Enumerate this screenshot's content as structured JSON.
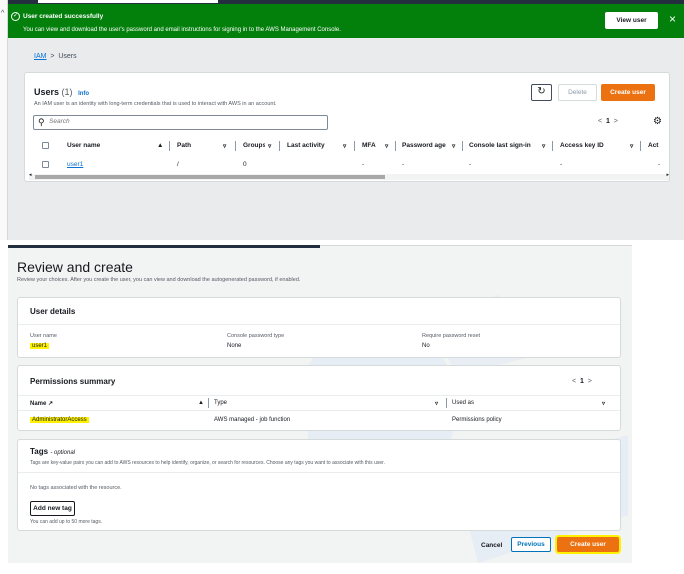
{
  "users_screen": {
    "flash": {
      "title": "User created successfully",
      "message": "You can view and download the user's password and email instructions for signing in to the AWS Management Console.",
      "view_button": "View user",
      "close_icon": "close-icon",
      "status_color": "#037f0c"
    },
    "breadcrumb": {
      "root": "IAM",
      "separator": ">",
      "current": "Users"
    },
    "panel": {
      "title": "Users",
      "count": "(1)",
      "info": "Info",
      "description": "An IAM user is an identity with long-term credentials that is used to interact with AWS in an account.",
      "refresh_icon": "refresh-icon",
      "delete_label": "Delete",
      "create_label": "Create user",
      "search_placeholder": "Search",
      "page": "1",
      "settings_icon": "gear-icon"
    },
    "table": {
      "columns": [
        "User name",
        "Path",
        "Groups",
        "Last activity",
        "MFA",
        "Password age",
        "Console last sign-in",
        "Access key ID",
        "Act"
      ],
      "rows": [
        {
          "user_name": "user1",
          "path": "/",
          "groups": "0",
          "last_activity": "-",
          "mfa": "-",
          "password_age": "-",
          "console_last_sign_in": "-",
          "access_key_id": "-",
          "act": "-"
        }
      ]
    }
  },
  "review_screen": {
    "title": "Review and create",
    "subtitle": "Review your choices. After you create the user, you can view and download the autogenerated password, if enabled.",
    "user_details": {
      "heading": "User details",
      "user_name_label": "User name",
      "user_name_value": "user1",
      "password_type_label": "Console password type",
      "password_type_value": "None",
      "reset_label": "Require password reset",
      "reset_value": "No"
    },
    "permissions": {
      "heading": "Permissions summary",
      "page": "1",
      "col_name": "Name",
      "col_type": "Type",
      "col_used_as": "Used as",
      "rows": [
        {
          "name": "AdministratorAccess",
          "type": "AWS managed - job function",
          "used_as": "Permissions policy"
        }
      ]
    },
    "tags": {
      "heading": "Tags",
      "optional": "- optional",
      "description": "Tags are key-value pairs you can add to AWS resources to help identify, organize, or search for resources. Choose any tags you want to associate with this user.",
      "empty": "No tags associated with the resource.",
      "add_button": "Add new tag",
      "limit": "You can add up to 50 more tags."
    },
    "footer": {
      "cancel": "Cancel",
      "previous": "Previous",
      "create": "Create user"
    }
  },
  "colors": {
    "accent": "#ec7211",
    "link": "#0972d3",
    "highlight": "#fff200"
  }
}
